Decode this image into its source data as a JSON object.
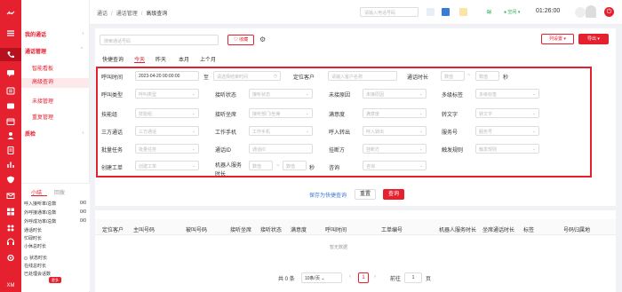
{
  "rail": {
    "bottom_label": "XM"
  },
  "sidebar": {
    "sections": [
      {
        "label": "我的通话"
      },
      {
        "label": "通话管理",
        "items": [
          "智能看板",
          "高级查询",
          "未接管理",
          "重复管理"
        ]
      },
      {
        "label": "质检"
      }
    ]
  },
  "stats": {
    "tabs": [
      "小结",
      "回拨"
    ],
    "rows": [
      {
        "label": "呼入接听率/总数",
        "value": "0/0"
      },
      {
        "label": "外呼接通率/总数",
        "value": "0/0"
      },
      {
        "label": "外呼成功率/总数",
        "value": "0/0"
      },
      {
        "label": "通话时长",
        "value": ""
      },
      {
        "label": "忙碌时长",
        "value": ""
      },
      {
        "label": "小休总时长",
        "value": ""
      },
      {
        "label": "状态时长",
        "value": ""
      },
      {
        "label": "在线总时长",
        "value": ""
      },
      {
        "label": "已处理会话数",
        "value": ""
      }
    ],
    "more": "更多"
  },
  "topbar": {
    "breadcrumb": [
      "通话",
      "通话管理",
      "高级查询"
    ],
    "search_placeholder": "请输入电话号码",
    "status": "空闲",
    "time": "01:26:00"
  },
  "toolbar": {
    "search_placeholder": "搜索通话号码",
    "collect": "收藏",
    "column_settings": "列设置",
    "export": "导出"
  },
  "quick": {
    "label": "快捷查询",
    "tabs": [
      "今天",
      "昨天",
      "本月",
      "上个月"
    ],
    "active": "今天"
  },
  "filters": {
    "call_time_label": "呼叫时间",
    "call_time_start": "2023-04-20 00:00:00",
    "to": "至",
    "call_time_end_placeholder": "请选择结束时间",
    "locate_customer_label": "定位客户",
    "locate_customer_placeholder": "请输入客户名称",
    "duration_label": "通话时长",
    "duration_min": "数值",
    "duration_max": "数值",
    "duration_unit": "秒",
    "call_type_label": "呼叫类型",
    "call_type_placeholder": "呼叫类型",
    "answer_status_label": "接听状态",
    "answer_status_placeholder": "接听状态",
    "unanswered_reason_label": "未接原因",
    "unanswered_reason_placeholder": "未接原因",
    "multi_tag_label": "多级标签",
    "multi_tag_placeholder": "多级标签",
    "skill_group_label": "技能组",
    "skill_group_placeholder": "技能组",
    "answer_seat_label": "接听坐席",
    "answer_seat_placeholder": "接听部门/坐席",
    "satisfaction_label": "满意度",
    "satisfaction_placeholder": "满意度",
    "to_text_label": "转文字",
    "to_text_placeholder": "转文字",
    "three_way_label": "三方通话",
    "three_way_placeholder": "三方通话",
    "work_phone_label": "工作手机",
    "work_phone_placeholder": "工作手机",
    "inbound_transfer_label": "呼入转出",
    "inbound_transfer_placeholder": "呼入转出",
    "service_no_label": "服务号",
    "service_no_placeholder": "服务号",
    "batch_task_label": "批量任务",
    "batch_task_placeholder": "批量任务",
    "call_id_label": "通话ID",
    "call_id_placeholder": "通话ID",
    "hangup_label": "挂断方",
    "hangup_placeholder": "挂断方",
    "trigger_rule_label": "触发规则",
    "trigger_rule_placeholder": "触发规则",
    "ticket_label": "创建工单",
    "ticket_placeholder": "创建工单",
    "robot_duration_label_1": "机器人服务",
    "robot_duration_label_2": "时长",
    "robot_min": "数值",
    "robot_tilde": "~",
    "robot_max": "数值",
    "robot_unit": "秒",
    "consult_label": "咨询",
    "consult_placeholder": "咨询"
  },
  "actions": {
    "save_quick": "保存为快捷查询",
    "reset": "重置",
    "query": "查询"
  },
  "table": {
    "columns": [
      "定位客户",
      "主叫号码",
      "被叫号码",
      "接听坐席",
      "接听状态",
      "满意度",
      "呼叫时间",
      "工单编号",
      "机器人服务时长",
      "坐席通话时长",
      "标签",
      "号码归属地"
    ],
    "empty": "暂无数据"
  },
  "pagination": {
    "total": "共 0 条",
    "page_size": "10条/页",
    "prev": "‹",
    "current": "1",
    "next": "›",
    "goto_label": "前往",
    "goto_value": "1",
    "page_unit": "页"
  },
  "colors": {
    "brand": "#e5202f",
    "link": "#3a7bd5",
    "online": "#2fa84f"
  }
}
